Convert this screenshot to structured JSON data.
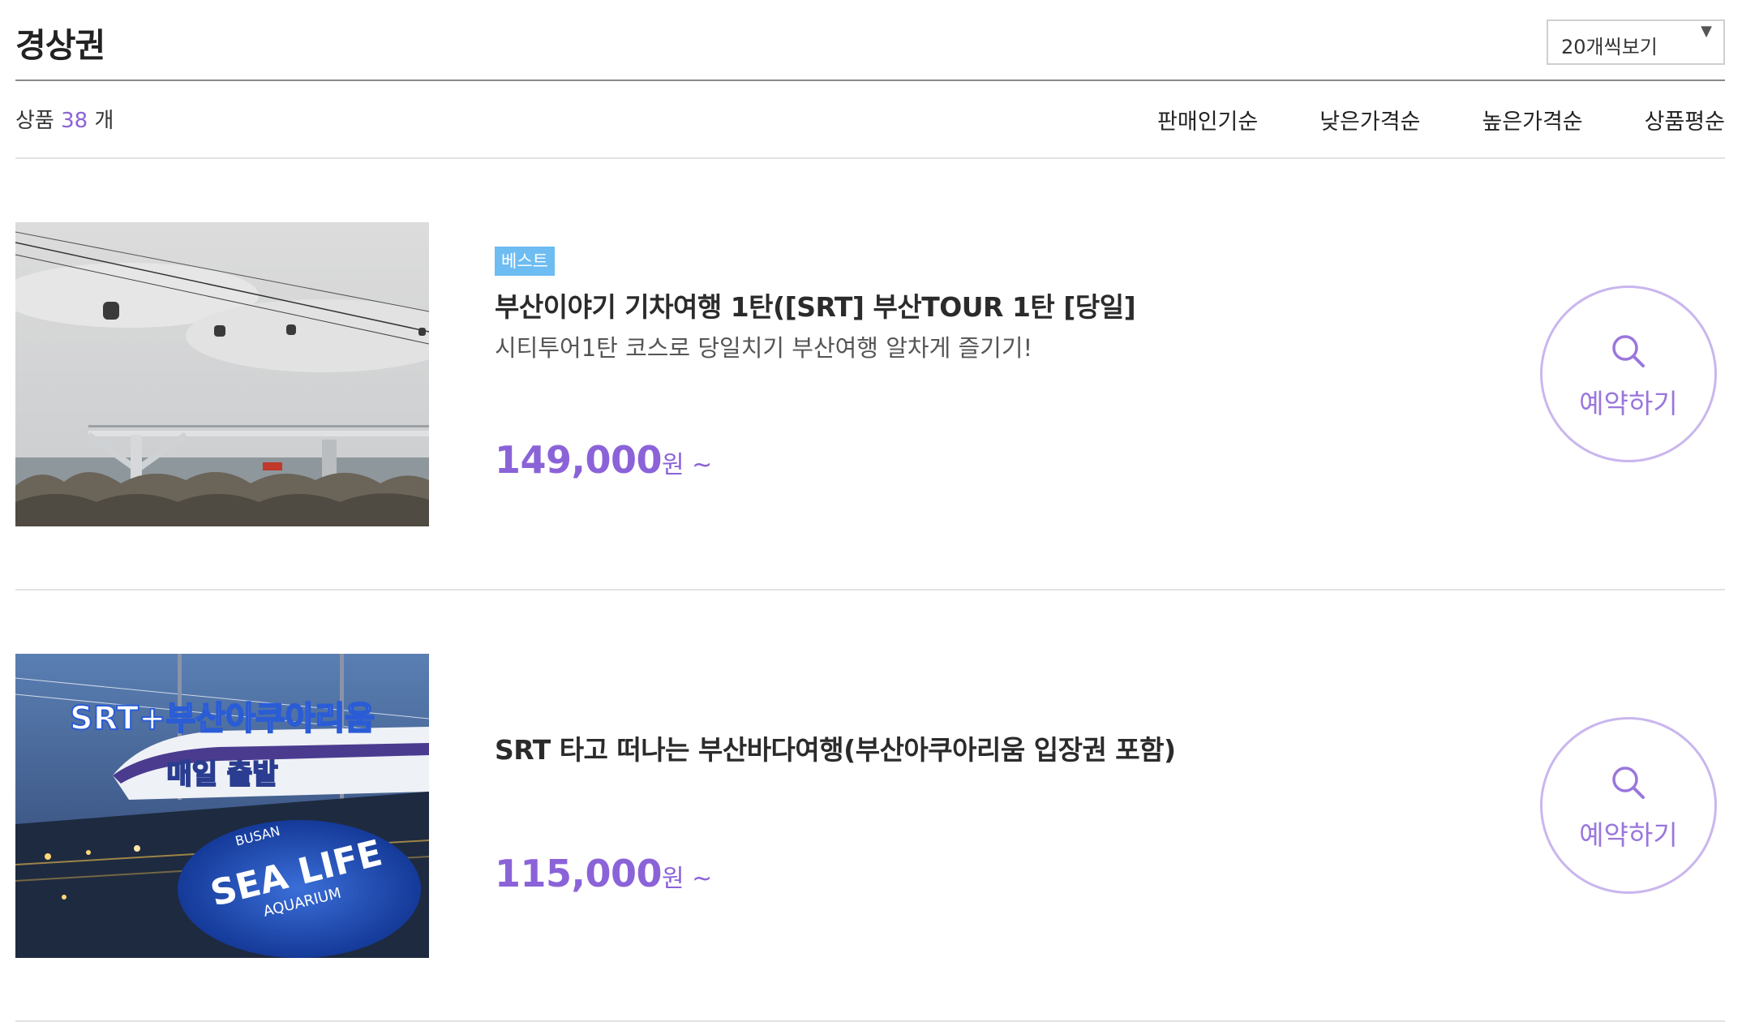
{
  "header": {
    "title": "경상권",
    "per_page": {
      "selected": "20개씩보기"
    }
  },
  "toolbar": {
    "count_prefix": "상품",
    "count_value": "38",
    "count_suffix": "개",
    "sort_options": [
      "판매인기순",
      "낮은가격순",
      "높은가격순",
      "상품평순"
    ]
  },
  "products": [
    {
      "badge": "베스트",
      "name": "부산이야기 기차여행 1탄([SRT] 부산TOUR 1탄 [당일]",
      "desc": "시티투어1탄 코스로 당일치기 부산여행 알차게 즐기기!",
      "price": "149,000",
      "unit": "원 ~",
      "button": "예약하기"
    },
    {
      "name": "SRT 타고 떠나는 부산바다여행(부산아쿠아리움 입장권 포함)",
      "price": "115,000",
      "unit": "원 ~",
      "button": "예약하기",
      "image_text": {
        "line1": "SRT+부산아쿠아리움",
        "line2": "매일 출발",
        "logo_top": "BUSAN",
        "logo_main": "SEA LIFE",
        "logo_bottom": "AQUARIUM"
      }
    }
  ],
  "colors": {
    "accent": "#8b63d8",
    "badge": "#6dbcf2",
    "button_border": "#c9b6ee"
  },
  "icons": {
    "search": "search-icon",
    "dropdown": "dropdown-arrow-icon"
  }
}
